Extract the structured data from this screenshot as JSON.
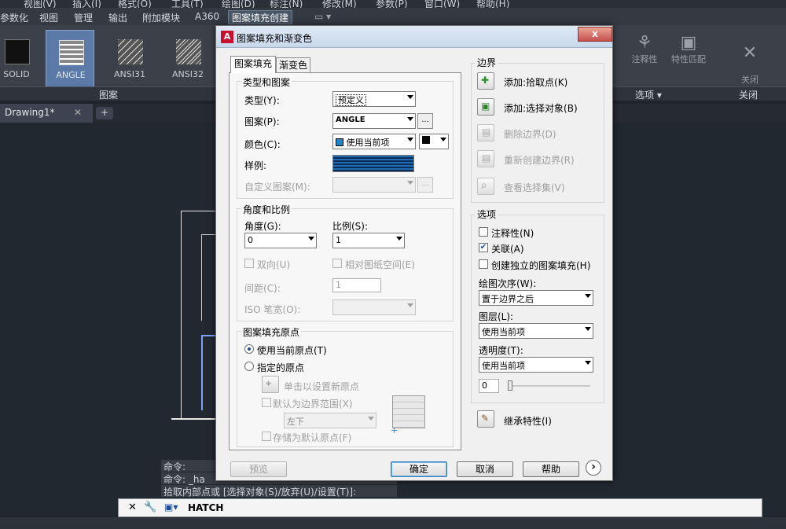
{
  "menu": [
    "参数化",
    "视图",
    "管理",
    "输出",
    "附加模块",
    "A360",
    "图案填充创建"
  ],
  "menu_top": [
    "视图(V)",
    "插入(I)",
    "格式(O)",
    "工具(T)",
    "绘图(D)",
    "标注(N)",
    "修改(M)",
    "参数(P)",
    "窗口(W)",
    "帮助(H)"
  ],
  "ribbon": {
    "swatches": [
      "SOLID",
      "ANGLE",
      "ANSI31",
      "ANSI32"
    ],
    "right_buttons": [
      "注释性",
      "特性匹配",
      "关闭\n图案填充创建"
    ],
    "footer": {
      "pattern": "图案",
      "options": "选项 ▾",
      "close": "关闭"
    }
  },
  "doc": {
    "tab": "Drawing1*",
    "close": "✕",
    "add": "+"
  },
  "command": {
    "history": [
      "命令:",
      "命令: _ha",
      "拾取内部点或 [选择对象(S)/放弃(U)/设置(T)]:"
    ],
    "current": "HATCH"
  },
  "dialog": {
    "title": "图案填充和渐变色",
    "close": "x",
    "tabs": [
      "图案填充",
      "渐变色"
    ],
    "type_pattern": {
      "title": "类型和图案",
      "type_label": "类型(Y):",
      "type_value": "预定义",
      "pattern_label": "图案(P):",
      "pattern_value": "ANGLE",
      "color_label": "颜色(C):",
      "color_value": "使用当前项",
      "sample_label": "样例:",
      "custom_label": "自定义图案(M):"
    },
    "angle_scale": {
      "title": "角度和比例",
      "angle_label": "角度(G):",
      "angle_value": "0",
      "scale_label": "比例(S):",
      "scale_value": "1",
      "double_label": "双向(U)",
      "relative_label": "相对图纸空间(E)",
      "spacing_label": "间距(C):",
      "spacing_value": "1",
      "iso_label": "ISO 笔宽(O):"
    },
    "origin": {
      "title": "图案填充原点",
      "current_label": "使用当前原点(T)",
      "specified_label": "指定的原点",
      "click_label": "单击以设置新原点",
      "default_label": "默认为边界范围(X)",
      "position_value": "左下",
      "store_label": "存储为默认原点(F)"
    },
    "boundary": {
      "title": "边界",
      "add_pick": "添加:拾取点(K)",
      "add_select": "添加:选择对象(B)",
      "remove": "删除边界(D)",
      "recreate": "重新创建边界(R)",
      "view": "查看选择集(V)"
    },
    "options": {
      "title": "选项",
      "annotative": "注释性(N)",
      "associative": "关联(A)",
      "separate": "创建独立的图案填充(H)",
      "draw_order_label": "绘图次序(W):",
      "draw_order_value": "置于边界之后",
      "layer_label": "图层(L):",
      "layer_value": "使用当前项",
      "transparency_label": "透明度(T):",
      "transparency_value": "使用当前项",
      "transparency_amount": "0"
    },
    "inherit": "继承特性(I)",
    "buttons": {
      "preview": "预览",
      "ok": "确定",
      "cancel": "取消",
      "help": "帮助",
      "more": "›"
    }
  },
  "colors": {
    "accent": "#1a4a9a",
    "title": "#c8102e"
  }
}
